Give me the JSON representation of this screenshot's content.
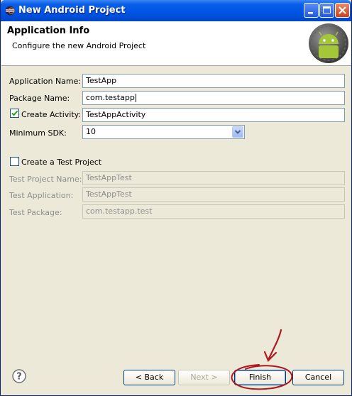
{
  "window": {
    "title": "New Android Project"
  },
  "header": {
    "title": "Application Info",
    "subtitle": "Configure the new Android Project"
  },
  "form": {
    "app_name": {
      "label": "Application Name:",
      "value": "TestApp"
    },
    "package_name": {
      "label": "Package Name:",
      "value": "com.testapp"
    },
    "create_activity": {
      "label": "Create Activity:",
      "checked": true,
      "value": "TestAppActivity"
    },
    "min_sdk": {
      "label": "Minimum SDK:",
      "value": "10"
    }
  },
  "test_project": {
    "label": "Create a Test Project",
    "checked": false,
    "name": {
      "label": "Test Project Name:",
      "value": "TestAppTest"
    },
    "application": {
      "label": "Test Application:",
      "value": "TestAppTest"
    },
    "package": {
      "label": "Test Package:",
      "value": "com.testapp.test"
    }
  },
  "buttons": {
    "back": "< Back",
    "next": "Next >",
    "finish": "Finish",
    "cancel": "Cancel"
  },
  "icons": {
    "help": "help-icon",
    "minimize": "minimize-icon",
    "maximize": "maximize-icon",
    "close": "close-icon",
    "logo": "android-logo",
    "window": "eclipse-icon"
  },
  "colors": {
    "titlebar": "#0054e3",
    "annotation": "#b0171f",
    "checkmark": "#21a121"
  }
}
